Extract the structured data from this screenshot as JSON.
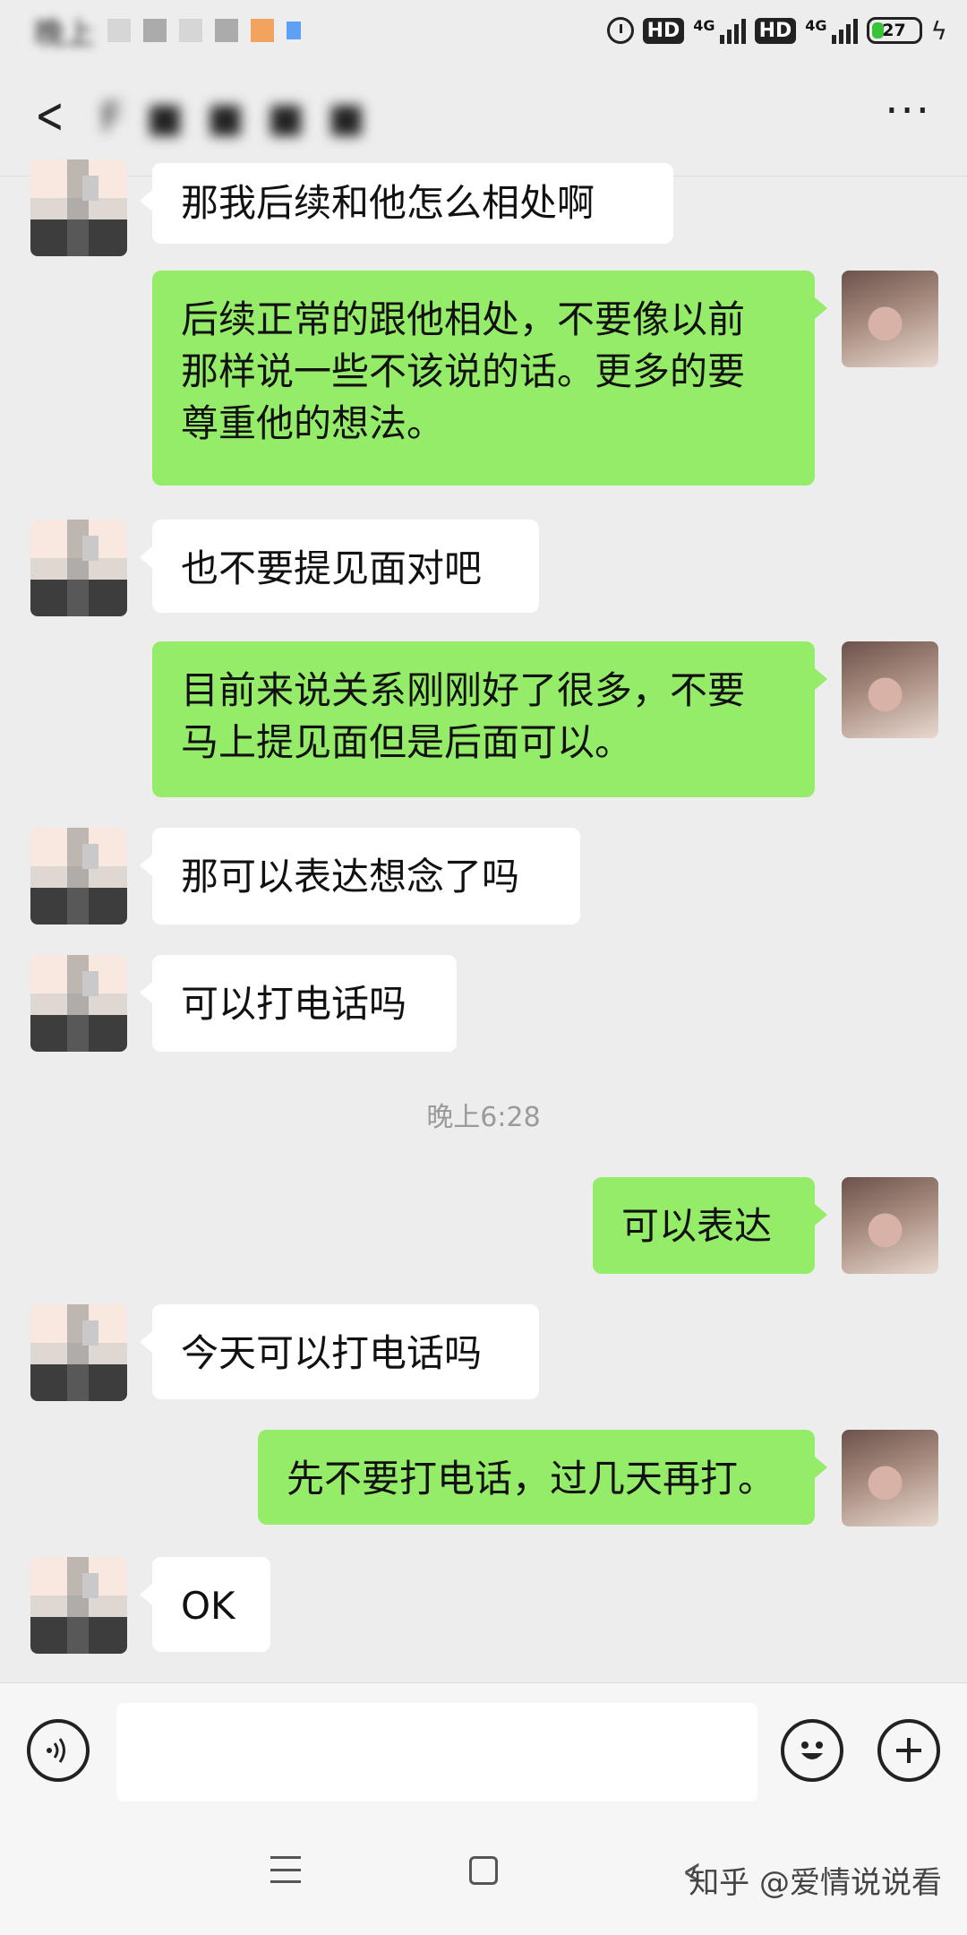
{
  "status_bar": {
    "network_labels": [
      "HD",
      "4G",
      "HD",
      "4G"
    ],
    "battery_level": "27",
    "battery_percent": 27
  },
  "header": {
    "more_label": "···"
  },
  "messages": [
    {
      "side": "in",
      "text": "那我后续和他怎么相处啊"
    },
    {
      "side": "out",
      "text": "后续正常的跟他相处，不要像以前\n那样说一些不该说的话。更多的要\n尊重他的想法。"
    },
    {
      "side": "in",
      "text": "也不要提见面对吧"
    },
    {
      "side": "out",
      "text": "目前来说关系刚刚好了很多，不要\n马上提见面但是后面可以。"
    },
    {
      "side": "in",
      "text": "那可以表达想念了吗"
    },
    {
      "side": "in",
      "text": "可以打电话吗"
    },
    {
      "side": "out",
      "text": "可以表达"
    },
    {
      "side": "in",
      "text": "今天可以打电话吗"
    },
    {
      "side": "out",
      "text": "先不要打电话，过几天再打。"
    },
    {
      "side": "in",
      "text": "OK"
    }
  ],
  "timestamp": "晚上6:28",
  "input_bar": {
    "placeholder": ""
  },
  "watermark": "知乎 @爱情说说看",
  "colors": {
    "background": "#ededed",
    "outgoing_bubble": "#95ec69",
    "incoming_bubble": "#ffffff"
  },
  "icons": [
    "back-arrow-icon",
    "more-icon",
    "voice-icon",
    "emoji-icon",
    "plus-icon",
    "menu-icon",
    "home-icon",
    "nav-back-icon"
  ]
}
